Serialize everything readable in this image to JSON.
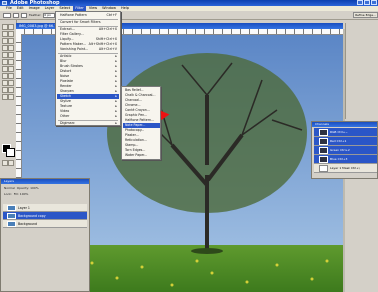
{
  "window": {
    "title": "Adobe Photoshop"
  },
  "menubar": [
    "File",
    "Edit",
    "Image",
    "Layer",
    "Select",
    "Filter",
    "View",
    "Window",
    "Help"
  ],
  "active_menu": "Filter",
  "options_bar": {
    "feather_label": "Feather:",
    "feather_value": "0 px",
    "style_label": "Style:",
    "style_value": "Normal",
    "refine_button": "Refine Edge..."
  },
  "document": {
    "tab_title": "IMG_0083.jpg @ 66.7% (Layer 1, RGB/8)"
  },
  "filter_menu": {
    "items": [
      {
        "label": "Halftone Pattern",
        "shortcut": "Ctrl+F"
      },
      {
        "label": "Convert for Smart Filters",
        "shortcut": ""
      },
      {
        "label": "Extract...",
        "shortcut": "Alt+Ctrl+X"
      },
      {
        "label": "Filter Gallery...",
        "shortcut": ""
      },
      {
        "label": "Liquify...",
        "shortcut": "Shift+Ctrl+X"
      },
      {
        "label": "Pattern Maker...",
        "shortcut": "Alt+Shift+Ctrl+X"
      },
      {
        "label": "Vanishing Point...",
        "shortcut": "Alt+Ctrl+V"
      },
      {
        "label": "Artistic",
        "shortcut": ""
      },
      {
        "label": "Blur",
        "shortcut": ""
      },
      {
        "label": "Brush Strokes",
        "shortcut": ""
      },
      {
        "label": "Distort",
        "shortcut": ""
      },
      {
        "label": "Noise",
        "shortcut": ""
      },
      {
        "label": "Pixelate",
        "shortcut": ""
      },
      {
        "label": "Render",
        "shortcut": ""
      },
      {
        "label": "Sharpen",
        "shortcut": ""
      },
      {
        "label": "Sketch",
        "shortcut": ""
      },
      {
        "label": "Stylize",
        "shortcut": ""
      },
      {
        "label": "Texture",
        "shortcut": ""
      },
      {
        "label": "Video",
        "shortcut": ""
      },
      {
        "label": "Other",
        "shortcut": ""
      },
      {
        "label": "Digimarc",
        "shortcut": ""
      }
    ],
    "selected": "Sketch"
  },
  "sketch_submenu": {
    "items": [
      "Bas Relief...",
      "Chalk & Charcoal...",
      "Charcoal...",
      "Chrome...",
      "Conté Crayon...",
      "Graphic Pen...",
      "Halftone Pattern...",
      "Note Paper...",
      "Photocopy...",
      "Plaster...",
      "Reticulation...",
      "Stamp...",
      "Torn Edges...",
      "Water Paper..."
    ],
    "selected": "Note Paper..."
  },
  "layers_panel": {
    "title": "Layers",
    "mode": "Normal",
    "opacity_label": "Opacity:",
    "opacity": "100%",
    "lock_label": "Lock:",
    "fill_label": "Fill:",
    "fill": "100%",
    "layers": [
      "Layer 1",
      "Background copy",
      "Background"
    ],
    "selected": "Background copy"
  },
  "channels_panel": {
    "title": "Channels",
    "channels": [
      {
        "name": "RGB",
        "shortcut": "Ctrl+~"
      },
      {
        "name": "Red",
        "shortcut": "Ctrl+1"
      },
      {
        "name": "Green",
        "shortcut": "Ctrl+2"
      },
      {
        "name": "Blue",
        "shortcut": "Ctrl+3"
      },
      {
        "name": "Layer 1 Mask",
        "shortcut": "Ctrl+\\"
      }
    ]
  }
}
